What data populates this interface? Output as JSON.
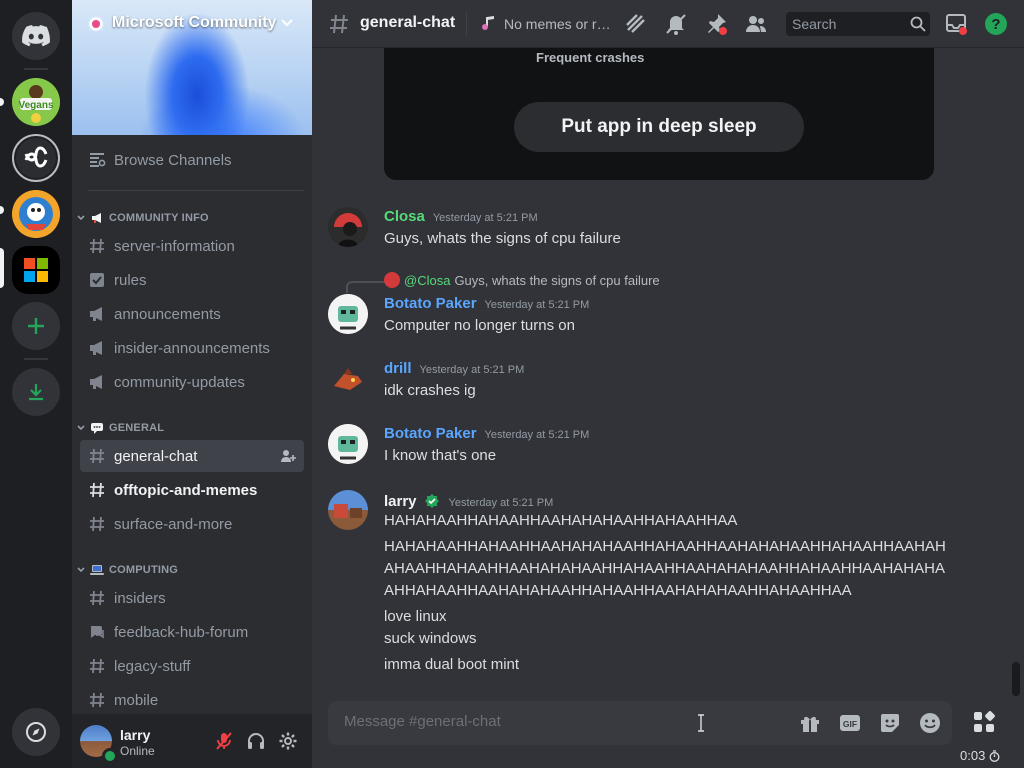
{
  "server_rail": {
    "items": [
      {
        "name": "Direct Messages"
      },
      {
        "name": "Vegans"
      },
      {
        "name": "Server 3"
      },
      {
        "name": "Server 4"
      },
      {
        "name": "Microsoft Community"
      },
      {
        "name": "Add a Server"
      },
      {
        "name": "Download Apps"
      },
      {
        "name": "Discover"
      }
    ]
  },
  "server": {
    "name": "Microsoft Community"
  },
  "sidebar": {
    "browse_label": "Browse Channels",
    "categories": [
      {
        "label": "COMMUNITY INFO",
        "channels": [
          {
            "label": "server-information",
            "icon": "hash"
          },
          {
            "label": "rules",
            "icon": "rules-checkbox"
          },
          {
            "label": "announcements",
            "icon": "megaphone"
          },
          {
            "label": "insider-announcements",
            "icon": "megaphone"
          },
          {
            "label": "community-updates",
            "icon": "megaphone"
          }
        ]
      },
      {
        "label": "GENERAL",
        "channels": [
          {
            "label": "general-chat",
            "icon": "hash",
            "selected": true
          },
          {
            "label": "offtopic-and-memes",
            "icon": "hash",
            "unread": true
          },
          {
            "label": "surface-and-more",
            "icon": "hash"
          }
        ]
      },
      {
        "label": "COMPUTING",
        "channels": [
          {
            "label": "insiders",
            "icon": "hash"
          },
          {
            "label": "feedback-hub-forum",
            "icon": "forum"
          },
          {
            "label": "legacy-stuff",
            "icon": "hash"
          },
          {
            "label": "mobile",
            "icon": "hash"
          }
        ]
      }
    ]
  },
  "user_panel": {
    "username": "larry",
    "status": "Online"
  },
  "header": {
    "channel": "general-chat",
    "topic": "No memes or ra...",
    "search_placeholder": "Search"
  },
  "embed": {
    "subtitle": "Frequent crashes",
    "button_label": "Put app in deep sleep"
  },
  "messages": [
    {
      "author": "Closa",
      "color": "#57d97a",
      "timestamp": "Yesterday at 5:21 PM",
      "lines": [
        "Guys, whats the signs of cpu failure"
      ]
    },
    {
      "author": "Botato Paker",
      "color": "#5aa6ff",
      "timestamp": "Yesterday at 5:21 PM",
      "reply": {
        "mention": "@Closa",
        "text": "Guys, whats the signs of cpu failure"
      },
      "lines": [
        "Computer no longer turns on"
      ]
    },
    {
      "author": "drill",
      "color": "#5aa6ff",
      "timestamp": "Yesterday at 5:21 PM",
      "lines": [
        "idk crashes ig"
      ]
    },
    {
      "author": "Botato Paker",
      "color": "#5aa6ff",
      "timestamp": "Yesterday at 5:21 PM",
      "lines": [
        "I know that's one"
      ]
    },
    {
      "author": "larry",
      "color": "#f2f3f5",
      "timestamp": "Yesterday at 5:21 PM",
      "lines": [
        "HAHAHAAHHAHAAHHAAHAHAHAAHHAHAAHHAA",
        "HAHAHAAHHAHAAHHAAHAHAHAAHHAHAAHHAAHAHAHAAHHAHAAHHAAHAH",
        "AHAAHHAHAAHHAAHAHAHAAHHAHAAHHAAHAHAHAAHHAHAAHHAAHAHAHA",
        "AHHAHAAHHAAHAHAHAAHHAHAAHHAAHAHAHAAHHAHAAHHAA",
        "love linux",
        "suck windows",
        "imma dual boot mint"
      ]
    }
  ],
  "composer": {
    "placeholder": "Message #general-chat"
  },
  "timer": "0:03"
}
